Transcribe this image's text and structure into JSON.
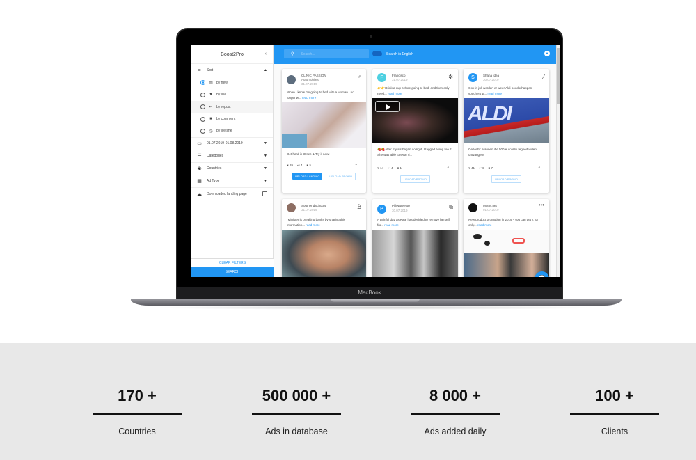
{
  "laptop": {
    "brand": "MacBook"
  },
  "app": {
    "title": "Boost2Pro",
    "sidebar": {
      "collapse_icon": "chevron-left",
      "sort": {
        "label": "Sort",
        "options": [
          {
            "label": "by new",
            "icon": "calendar-grid",
            "selected": true
          },
          {
            "label": "by like",
            "icon": "heart",
            "selected": false
          },
          {
            "label": "by repost",
            "icon": "reply",
            "selected": false
          },
          {
            "label": "by comment",
            "icon": "comment",
            "selected": false
          },
          {
            "label": "by lifetime",
            "icon": "timer",
            "selected": false
          }
        ]
      },
      "date_range": "01.07.2019-01.08.2019",
      "filters": [
        {
          "label": "Categories",
          "icon": "list"
        },
        {
          "label": "Countries",
          "icon": "globe"
        },
        {
          "label": "Ad Type",
          "icon": "grid"
        }
      ],
      "downloaded_landing_label": "Downloaded landing page",
      "downloaded_landing_checked": false,
      "clear_filters": "CLEAR FILTERS",
      "search": "SEARCH"
    },
    "topbar": {
      "search_placeholder": "Search...",
      "toggle_label": "Search in English",
      "toggle_on": false
    },
    "cards": [
      {
        "author": "CLINIC PASSION",
        "subtitle": "Automobiles",
        "date": "31.07.2019",
        "type_icon": "male-symbol",
        "description": "When I know I'm going to bed with a woman I no longer w...",
        "read_more": "read more",
        "caption": "Get hard in 30sec & Try it now!",
        "likes": "39",
        "reposts": "4",
        "comments": "5",
        "buttons": [
          "UPLOAD LANDING",
          "UPLOAD PROMO"
        ]
      },
      {
        "author": "Francisco",
        "avatar_letter": "F",
        "avatar_color": "#4dd0e1",
        "date": "31.07.2019",
        "type_icon": "bug",
        "description": "👉👉Drink a cup before going to bed, and then only need...",
        "read_more": "read more",
        "caption": "🍓🍓After my sis began doing it, I tagged along too.If She was able to wear ti...",
        "likes": "14",
        "reposts": "4",
        "comments": "1",
        "buttons": [
          "UPLOAD PROMO"
        ],
        "has_video": true
      },
      {
        "author": "Shana Idea",
        "avatar_letter": "S",
        "avatar_color": "#2196f3",
        "date": "30.07.2019",
        "type_icon": "magic-wand",
        "description": "Ook in juli worden er weer Aldi boodschappen vouchers w...",
        "read_more": "read more",
        "caption": "Gezocht: Mannen die 500 euro Aldi tegoed willen ontvangen!",
        "likes": "41",
        "reposts": "6",
        "comments": "7",
        "buttons": [
          "UPLOAD PROMO"
        ]
      },
      {
        "author": "SouthendSchools",
        "date": "31.07.2019",
        "type_icon": "bitcoin",
        "description": "\"Minister is breaking banks by sharing this information...",
        "read_more": "read more"
      },
      {
        "author": "Pillowtreetop",
        "avatar_letter": "P",
        "avatar_color": "#2196f3",
        "date": "30.07.2019",
        "type_icon": "copy-gear",
        "description": "A painful day as Kate has decided to remove herself fro...",
        "read_more": "read more"
      },
      {
        "author": "Motos.net",
        "date": "01.07.2019",
        "type_icon": "more-horizontal",
        "description": "New product promotion in 2019 - You can get it for only...",
        "read_more": "read more"
      }
    ]
  },
  "stats": [
    {
      "value": "170 +",
      "label": "Countries"
    },
    {
      "value": "500 000 +",
      "label": "Ads in database"
    },
    {
      "value": "8 000 +",
      "label": "Ads added daily"
    },
    {
      "value": "100 +",
      "label": "Clients"
    }
  ]
}
